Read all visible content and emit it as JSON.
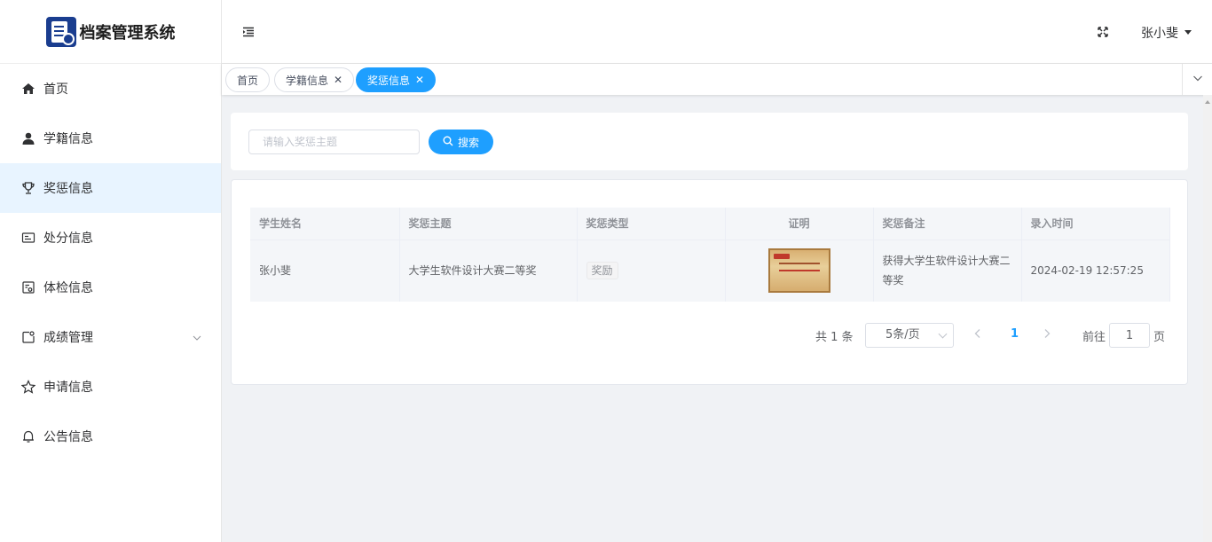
{
  "app": {
    "title": "档案管理系统"
  },
  "sidebar": {
    "items": [
      {
        "label": "首页",
        "icon": "home-icon"
      },
      {
        "label": "学籍信息",
        "icon": "user-icon"
      },
      {
        "label": "奖惩信息",
        "icon": "trophy-icon",
        "active": true
      },
      {
        "label": "处分信息",
        "icon": "id-card-icon"
      },
      {
        "label": "体检信息",
        "icon": "checklist-icon"
      },
      {
        "label": "成绩管理",
        "icon": "score-icon",
        "expandable": true
      },
      {
        "label": "申请信息",
        "icon": "star-icon"
      },
      {
        "label": "公告信息",
        "icon": "bell-icon"
      }
    ]
  },
  "header": {
    "user": "张小斐"
  },
  "tabs": [
    {
      "label": "首页",
      "closable": false
    },
    {
      "label": "学籍信息",
      "closable": true
    },
    {
      "label": "奖惩信息",
      "closable": true,
      "active": true
    }
  ],
  "search": {
    "placeholder": "请输入奖惩主题",
    "value": "",
    "button_label": "搜索"
  },
  "table": {
    "columns": [
      "学生姓名",
      "奖惩主题",
      "奖惩类型",
      "证明",
      "奖惩备注",
      "录入时间"
    ],
    "rows": [
      {
        "student_name": "张小斐",
        "topic": "大学生软件设计大赛二等奖",
        "type": "奖励",
        "proof": "certificate-image",
        "remark": "获得大学生软件设计大赛二等奖",
        "created_at": "2024-02-19 12:57:25"
      }
    ]
  },
  "pagination": {
    "total_text": "共 1 条",
    "page_size": "5条/页",
    "current_page": "1",
    "goto_label": "前往",
    "goto_value": "1",
    "page_suffix": "页"
  },
  "colors": {
    "primary": "#1e9fff",
    "active_menu_bg": "#e8f4ff"
  }
}
